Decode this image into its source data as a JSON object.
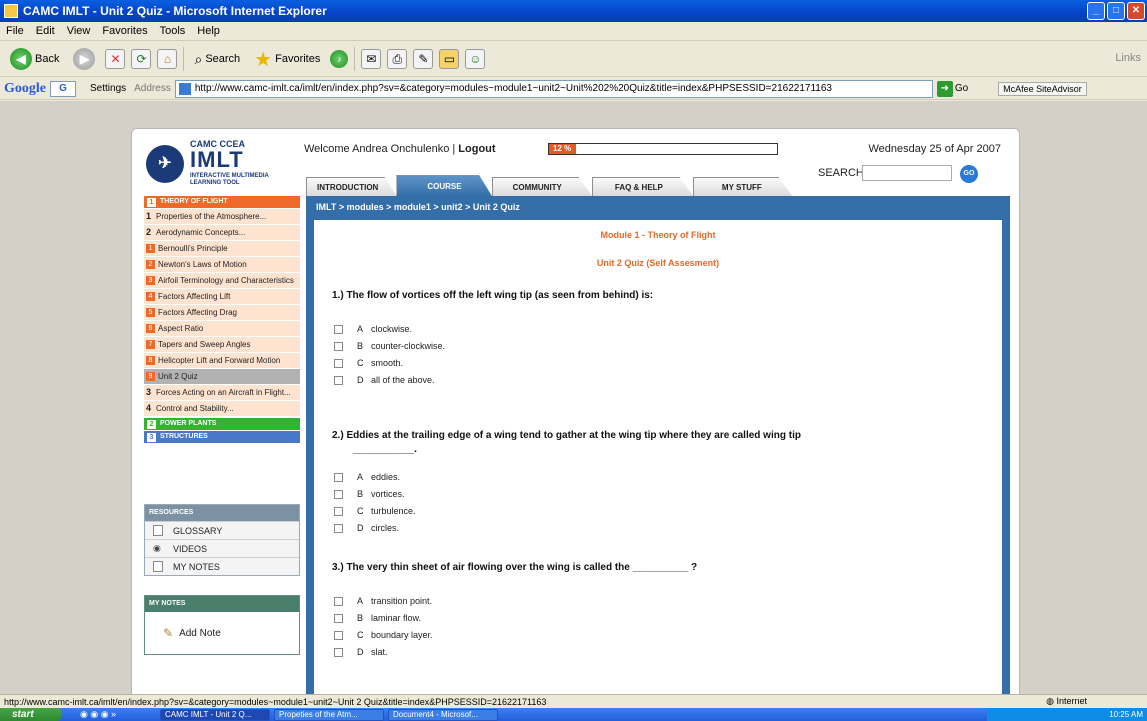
{
  "window": {
    "title": "CAMC IMLT - Unit 2 Quiz - Microsoft Internet Explorer",
    "menu": [
      "File",
      "Edit",
      "View",
      "Favorites",
      "Tools",
      "Help"
    ]
  },
  "toolbar": {
    "back": "Back",
    "search": "Search",
    "favorites": "Favorites",
    "links": "Links"
  },
  "address": {
    "google": "Google",
    "google_box": "G",
    "settings": "Settings",
    "label": "Address",
    "url": "http://www.camc-imlt.ca/imlt/en/index.php?sv=&category=modules~module1~unit2~Unit%202%20Quiz&title=index&PHPSESSID=21622171163",
    "go": "Go",
    "mcafee": "McAfee SiteAdvisor"
  },
  "header": {
    "logo_top": "CAMC CCEA",
    "logo_main": "IMLT",
    "logo_sub": "INTERACTIVE MULTIMEDIA LEARNING TOOL",
    "welcome": "Welcome Andrea Onchulenko | ",
    "logout": "Logout",
    "progress_label": "12 %",
    "progress_value": 0.12,
    "date": "Wednesday 25 of Apr 2007",
    "search_label": "SEARCH",
    "search_go": "GO"
  },
  "tabs": [
    "INTRODUCTION",
    "COURSE",
    "COMMUNITY",
    "FAQ & HELP",
    "MY STUFF"
  ],
  "sidebar": {
    "section1": "THEORY OF FLIGHT",
    "section1_num": "1",
    "items": [
      {
        "lvl": "1",
        "label": "Properties of the Atmosphere..."
      },
      {
        "lvl": "2",
        "label": "Aerodynamic Concepts..."
      },
      {
        "sq": "1",
        "label": "Bernoulli's Principle"
      },
      {
        "sq": "2",
        "label": "Newton's Laws of Motion"
      },
      {
        "sq": "3",
        "label": "Airfoil Terminology and Characteristics"
      },
      {
        "sq": "4",
        "label": "Factors Affecting Lift"
      },
      {
        "sq": "5",
        "label": "Factors Affecting Drag"
      },
      {
        "sq": "6",
        "label": "Aspect Ratio"
      },
      {
        "sq": "7",
        "label": "Tapers and Sweep Angles"
      },
      {
        "sq": "8",
        "label": "Helicopter Lift and Forward Motion"
      },
      {
        "sq": "9",
        "label": "Unit 2 Quiz"
      },
      {
        "lvl": "3",
        "label": "Forces Acting on an Aircraft in Flight..."
      },
      {
        "lvl": "4",
        "label": "Control and Stability..."
      }
    ],
    "section2": "POWER PLANTS",
    "section2_num": "2",
    "section3": "STRUCTURES",
    "section3_num": "3"
  },
  "resources": {
    "title": "RESOURCES",
    "items": [
      "GLOSSARY",
      "VIDEOS",
      "MY NOTES"
    ]
  },
  "notes": {
    "title": "MY NOTES",
    "add": "Add Note"
  },
  "breadcrumb": "IMLT > modules > module1 > unit2 > Unit 2 Quiz",
  "quiz": {
    "module_title": "Module 1 - Theory of Flight",
    "unit_title": "Unit 2 Quiz (Self Assesment)",
    "questions": [
      {
        "text": "1.) The flow of vortices off the left wing tip (as seen from behind) is:",
        "options": [
          [
            "A",
            "clockwise."
          ],
          [
            "B",
            "counter-clockwise."
          ],
          [
            "C",
            "smooth."
          ],
          [
            "D",
            "all of the above."
          ]
        ]
      },
      {
        "text": "2.) Eddies at the trailing edge of a wing tend to gather at the wing tip where they are called wing tip",
        "continuation": "___________.",
        "options": [
          [
            "A",
            "eddies."
          ],
          [
            "B",
            "vortices."
          ],
          [
            "C",
            "turbulence."
          ],
          [
            "D",
            "circles."
          ]
        ]
      },
      {
        "text": "3.) The very thin sheet of air flowing over the wing is called the __________ ?",
        "options": [
          [
            "A",
            "transition point."
          ],
          [
            "B",
            "laminar flow."
          ],
          [
            "C",
            "boundary layer."
          ],
          [
            "D",
            "slat."
          ]
        ]
      }
    ]
  },
  "status": {
    "url": "http://www.camc-imlt.ca/imlt/en/index.php?sv=&category=modules~module1~unit2~Unit 2 Quiz&title=index&PHPSESSID=21622171163",
    "zone": "Internet"
  },
  "taskbar": {
    "start": "start",
    "tasks": [
      "CAMC IMLT - Unit 2 Q...",
      "Propeties of the Atm...",
      "Document4 - Microsof..."
    ],
    "clock": "10:25 AM"
  }
}
